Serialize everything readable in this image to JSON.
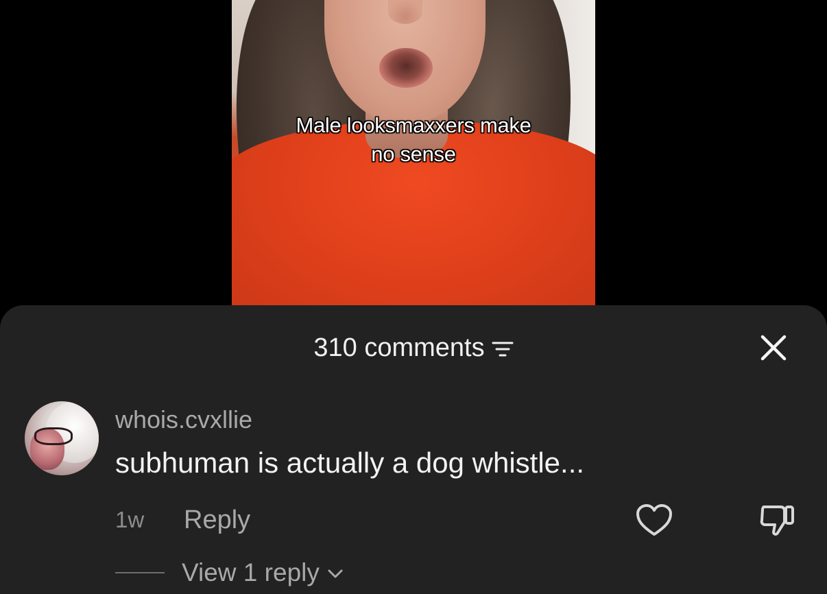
{
  "video": {
    "caption_line1": "Male looksmaxxers make",
    "caption_line2": "no sense"
  },
  "comments_sheet": {
    "title": "310 comments",
    "sort_icon": "filter-lines-icon",
    "close_icon": "close-icon",
    "background": "#222222"
  },
  "comment": {
    "username": "whois.cvxllie",
    "text": "subhuman is actually a dog whistle...",
    "timestamp": "1w",
    "reply_label": "Reply",
    "like_icon": "heart-icon",
    "dislike_icon": "thumbs-down-icon",
    "view_replies_label": "View 1 reply",
    "view_replies_icon": "chevron-down-icon"
  }
}
